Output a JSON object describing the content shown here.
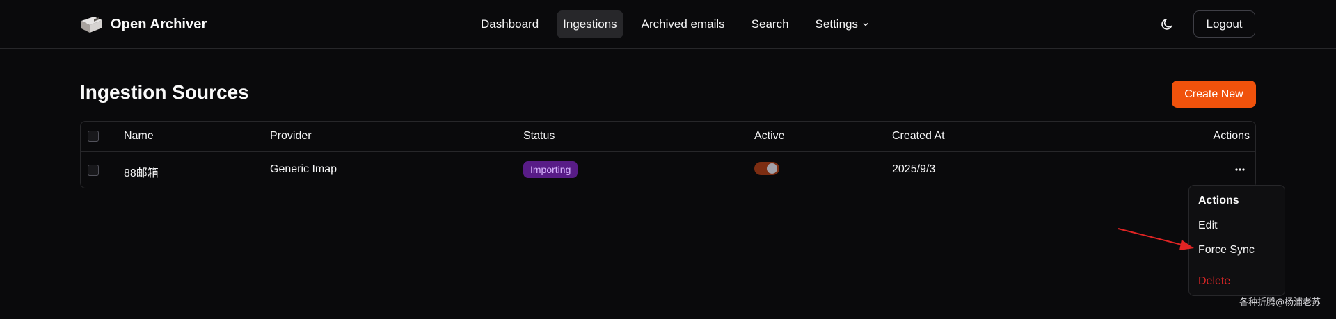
{
  "app": {
    "name": "Open Archiver"
  },
  "nav": {
    "items": [
      {
        "label": "Dashboard"
      },
      {
        "label": "Ingestions"
      },
      {
        "label": "Archived emails"
      },
      {
        "label": "Search"
      },
      {
        "label": "Settings"
      }
    ],
    "active": "Ingestions"
  },
  "header": {
    "logout_label": "Logout",
    "theme_icon": "moon-icon"
  },
  "page": {
    "title": "Ingestion Sources",
    "create_label": "Create New"
  },
  "table": {
    "columns": [
      "Name",
      "Provider",
      "Status",
      "Active",
      "Created At",
      "Actions"
    ],
    "rows": [
      {
        "name": "88邮箱",
        "provider": "Generic Imap",
        "status": "Importing",
        "active": true,
        "created_at": "2025/9/3"
      }
    ]
  },
  "menu": {
    "title": "Actions",
    "items": [
      {
        "label": "Edit"
      },
      {
        "label": "Force Sync"
      },
      {
        "label": "Delete"
      }
    ]
  },
  "watermark": "各种折腾@杨浦老苏",
  "colors": {
    "accent": "#f0520c",
    "badge_bg": "#581c87",
    "badge_text": "#d8b4fe",
    "danger": "#dc2626",
    "annotation_arrow": "#e02424"
  }
}
